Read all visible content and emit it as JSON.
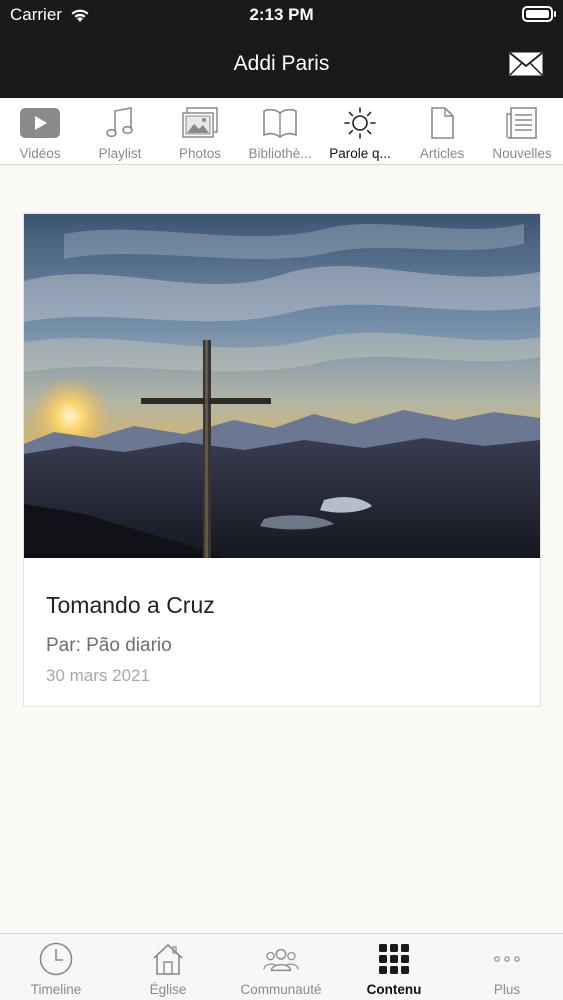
{
  "status_bar": {
    "carrier": "Carrier",
    "time": "2:13 PM"
  },
  "nav": {
    "title": "Addi Paris",
    "mail_icon": "mail-icon"
  },
  "content_tabs": [
    {
      "label": "Vidéos",
      "icon": "video-play-icon",
      "active": false
    },
    {
      "label": "Playlist",
      "icon": "music-note-icon",
      "active": false
    },
    {
      "label": "Photos",
      "icon": "photos-icon",
      "active": false
    },
    {
      "label": "Bibliothè...",
      "icon": "book-icon",
      "active": false
    },
    {
      "label": "Parole q...",
      "icon": "sun-icon",
      "active": true
    },
    {
      "label": "Articles",
      "icon": "document-icon",
      "active": false
    },
    {
      "label": "Nouvelles",
      "icon": "newspaper-icon",
      "active": false
    }
  ],
  "card": {
    "image": "sunset-cross-image",
    "title": "Tomando a Cruz",
    "author": "Par: Pão diario",
    "date": "30 mars 2021"
  },
  "bottom_tabs": [
    {
      "label": "Timeline",
      "icon": "clock-icon",
      "active": false
    },
    {
      "label": "Église",
      "icon": "church-icon",
      "active": false
    },
    {
      "label": "Communauté",
      "icon": "people-icon",
      "active": false
    },
    {
      "label": "Contenu",
      "icon": "grid-icon",
      "active": true
    },
    {
      "label": "Plus",
      "icon": "more-dots-icon",
      "active": false
    }
  ],
  "colors": {
    "bar": "#1a1a1a",
    "background": "#faf9f6",
    "active": "#111111",
    "inactive": "#8a8a8a"
  }
}
